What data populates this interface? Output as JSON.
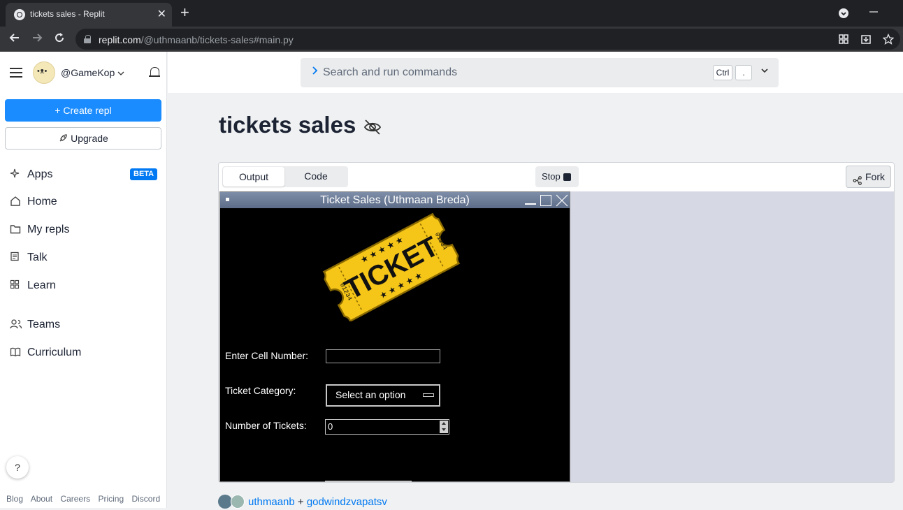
{
  "browser": {
    "tab_title": "tickets sales - Replit",
    "tab_close": "✕",
    "new_tab": "+",
    "url_host": "replit.com",
    "url_path": "/@uthmaanb/tickets-sales#main.py"
  },
  "sidebar": {
    "username": "@GameKop",
    "create_label": "+ Create repl",
    "upgrade_label": "Upgrade",
    "nav": [
      {
        "label": "Apps",
        "icon": "sparkle-icon",
        "badge": "BETA"
      },
      {
        "label": "Home",
        "icon": "home-icon"
      },
      {
        "label": "My repls",
        "icon": "folder-icon"
      },
      {
        "label": "Talk",
        "icon": "talk-icon"
      },
      {
        "label": "Learn",
        "icon": "learn-icon"
      },
      {
        "label": "Teams",
        "icon": "teams-icon"
      },
      {
        "label": "Curriculum",
        "icon": "book-icon"
      }
    ],
    "help_label": "?",
    "footer": [
      "Blog",
      "About",
      "Careers",
      "Pricing",
      "Discord"
    ]
  },
  "command_bar": {
    "placeholder": "Search and run commands",
    "kbd1": "Ctrl",
    "kbd2": "."
  },
  "repl": {
    "title": "tickets sales",
    "tabs": [
      "Output",
      "Code"
    ],
    "stop_label": "Stop",
    "fork_label": "Fork"
  },
  "tk_app": {
    "window_title": "Ticket Sales (Uthmaan Breda)",
    "ticket_image_text": "TICKET",
    "ticket_serial": "01234",
    "cell_label": "Enter Cell Number:",
    "cell_value": "",
    "category_label": "Ticket Category:",
    "category_value": "Select an option",
    "tickets_label": "Number of Tickets:",
    "tickets_value": "0"
  },
  "authors": {
    "first": "uthmaanb",
    "separator": "+",
    "second": "godwindzvapatsv"
  },
  "colors": {
    "accent": "#0079f2",
    "create_button": "#1a8cff",
    "ticket_gold": "#f5c518",
    "vnc_background": "#d6d8e4"
  }
}
